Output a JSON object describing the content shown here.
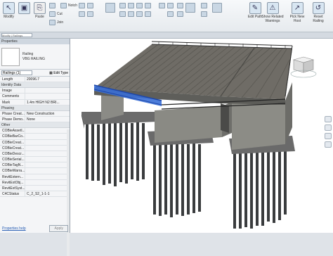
{
  "ribbon": {
    "modify_label": "Modify",
    "paste_label": "Paste",
    "cut_label": "Cut",
    "notch_label": "Notch",
    "join_label": "Join",
    "edit_path_label": "Edit Path",
    "show_related_label": "Show Related Warnings",
    "pick_new_host_label": "Pick New Host",
    "reset_railing_label": "Reset Railing"
  },
  "subbar": {
    "selector": "Modify | Railings"
  },
  "properties": {
    "title": "Properties",
    "family": "Railing",
    "type": "VBG RAILING",
    "instance_selector": "Railings (1)",
    "edit_type_label": "Edit Type",
    "rows_top": [
      {
        "k": "Length",
        "v": "20096.7"
      }
    ],
    "groups": [
      {
        "name": "Identity Data",
        "rows": [
          {
            "k": "Image",
            "v": ""
          },
          {
            "k": "Comments",
            "v": ""
          },
          {
            "k": "Mark",
            "v": "1.4m HIGH N2 BRI..."
          }
        ]
      },
      {
        "name": "Phasing",
        "rows": [
          {
            "k": "Phase Creat...",
            "v": "New Construction"
          },
          {
            "k": "Phase Demo...",
            "v": "None"
          }
        ]
      },
      {
        "name": "Other",
        "rows": [
          {
            "k": "COBieAssetI...",
            "v": ""
          },
          {
            "k": "COBieBarCo...",
            "v": ""
          },
          {
            "k": "COBieCreat...",
            "v": ""
          },
          {
            "k": "COBieCreat...",
            "v": ""
          },
          {
            "k": "COBieDescr...",
            "v": ""
          },
          {
            "k": "COBieSerial...",
            "v": ""
          },
          {
            "k": "COBieTagN...",
            "v": ""
          },
          {
            "k": "COBieWarra...",
            "v": ""
          },
          {
            "k": "RevitExtern...",
            "v": ""
          },
          {
            "k": "RevitExtObj...",
            "v": ""
          },
          {
            "k": "RevitExtSyst...",
            "v": ""
          },
          {
            "k": "C4CStatus",
            "v": "C_2_S2_1-1-1"
          }
        ]
      }
    ],
    "help_link": "Properties help",
    "apply_label": "Apply"
  }
}
